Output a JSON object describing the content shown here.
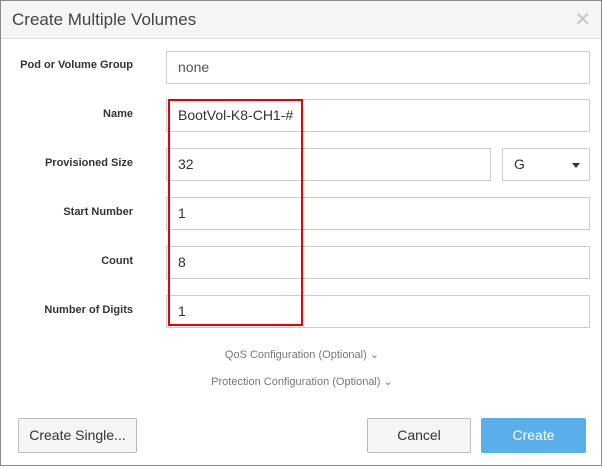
{
  "dialog": {
    "title": "Create Multiple Volumes"
  },
  "fields": [
    {
      "label": "Pod or Volume Group",
      "value": "none"
    },
    {
      "label": "Name",
      "value": "BootVol-K8-CH1-#"
    },
    {
      "label": "Provisioned Size",
      "value": "32",
      "unit": "G"
    },
    {
      "label": "Start Number",
      "value": "1"
    },
    {
      "label": "Count",
      "value": "8"
    },
    {
      "label": "Number of Digits",
      "value": "1"
    }
  ],
  "sections": {
    "qos": "QoS Configuration (Optional)",
    "protection": "Protection Configuration (Optional)"
  },
  "buttons": {
    "create_single": "Create Single...",
    "cancel": "Cancel",
    "create": "Create"
  },
  "colors": {
    "primary": "#5aaeea",
    "highlight": "#e00000"
  }
}
